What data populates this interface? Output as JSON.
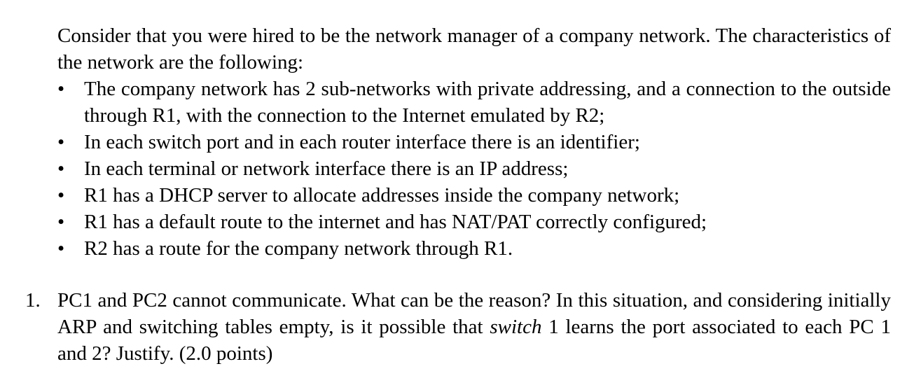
{
  "intro": "Consider that you were hired to be the network manager of a company network. The characteristics of the network are the following:",
  "bullet_symbol": "•",
  "bullets": [
    "The company network has 2 sub-networks with private addressing, and a connection to the outside through R1, with the connection to the Internet emulated by R2;",
    "In each switch port and in each router interface there is an identifier;",
    "In each terminal or network interface there is an IP address;",
    "R1 has a DHCP server to allocate addresses inside the company network;",
    "R1 has a default route to the internet and has NAT/PAT correctly configured;",
    "R2 has a route for the company network through R1."
  ],
  "question": {
    "number": "1.",
    "text_before": "PC1 and PC2 cannot communicate. What can be the reason? In this situation, and considering initially ARP and switching tables empty, is it possible that ",
    "emphasis": "switch",
    "text_after": " 1 learns the port associated to each PC 1 and 2? Justify. (2.0 points)"
  }
}
